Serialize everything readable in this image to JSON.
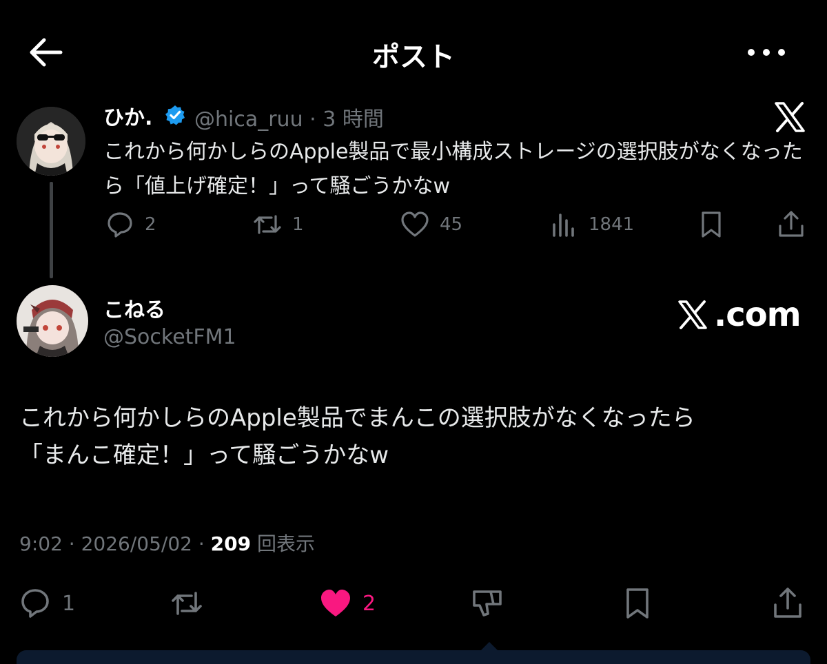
{
  "header": {
    "title": "ポスト",
    "back_icon": "arrow-left-icon",
    "more_icon": "more-horizontal-icon"
  },
  "quoted_post": {
    "name": "ひか.",
    "verified": true,
    "handle_time": "@hica_ruu · 3 時間",
    "text": "これから何かしらのApple製品で最小構成ストレージの選択肢がなくなったら「値上げ確定！」って騒ごうかなw",
    "actions": {
      "replies": "2",
      "reposts": "1",
      "likes": "45",
      "views": "1841"
    }
  },
  "main_post": {
    "name": "こねる",
    "handle": "@SocketFM1",
    "brand": ".com",
    "text_line1": "これから何かしらのApple製品でまんこの選択肢がなくなったら",
    "text_line2": "「まんこ確定！」って騒ごうかなw",
    "time_date": "9:02 · 2026/05/02 · ",
    "views_count": "209",
    "views_label": "回表示",
    "actions": {
      "replies": "1",
      "likes": "2"
    }
  },
  "colors": {
    "background": "#000000",
    "text": "#e7e9ea",
    "muted": "#71767b",
    "verified": "#1d9bf0",
    "like": "#f91880"
  }
}
